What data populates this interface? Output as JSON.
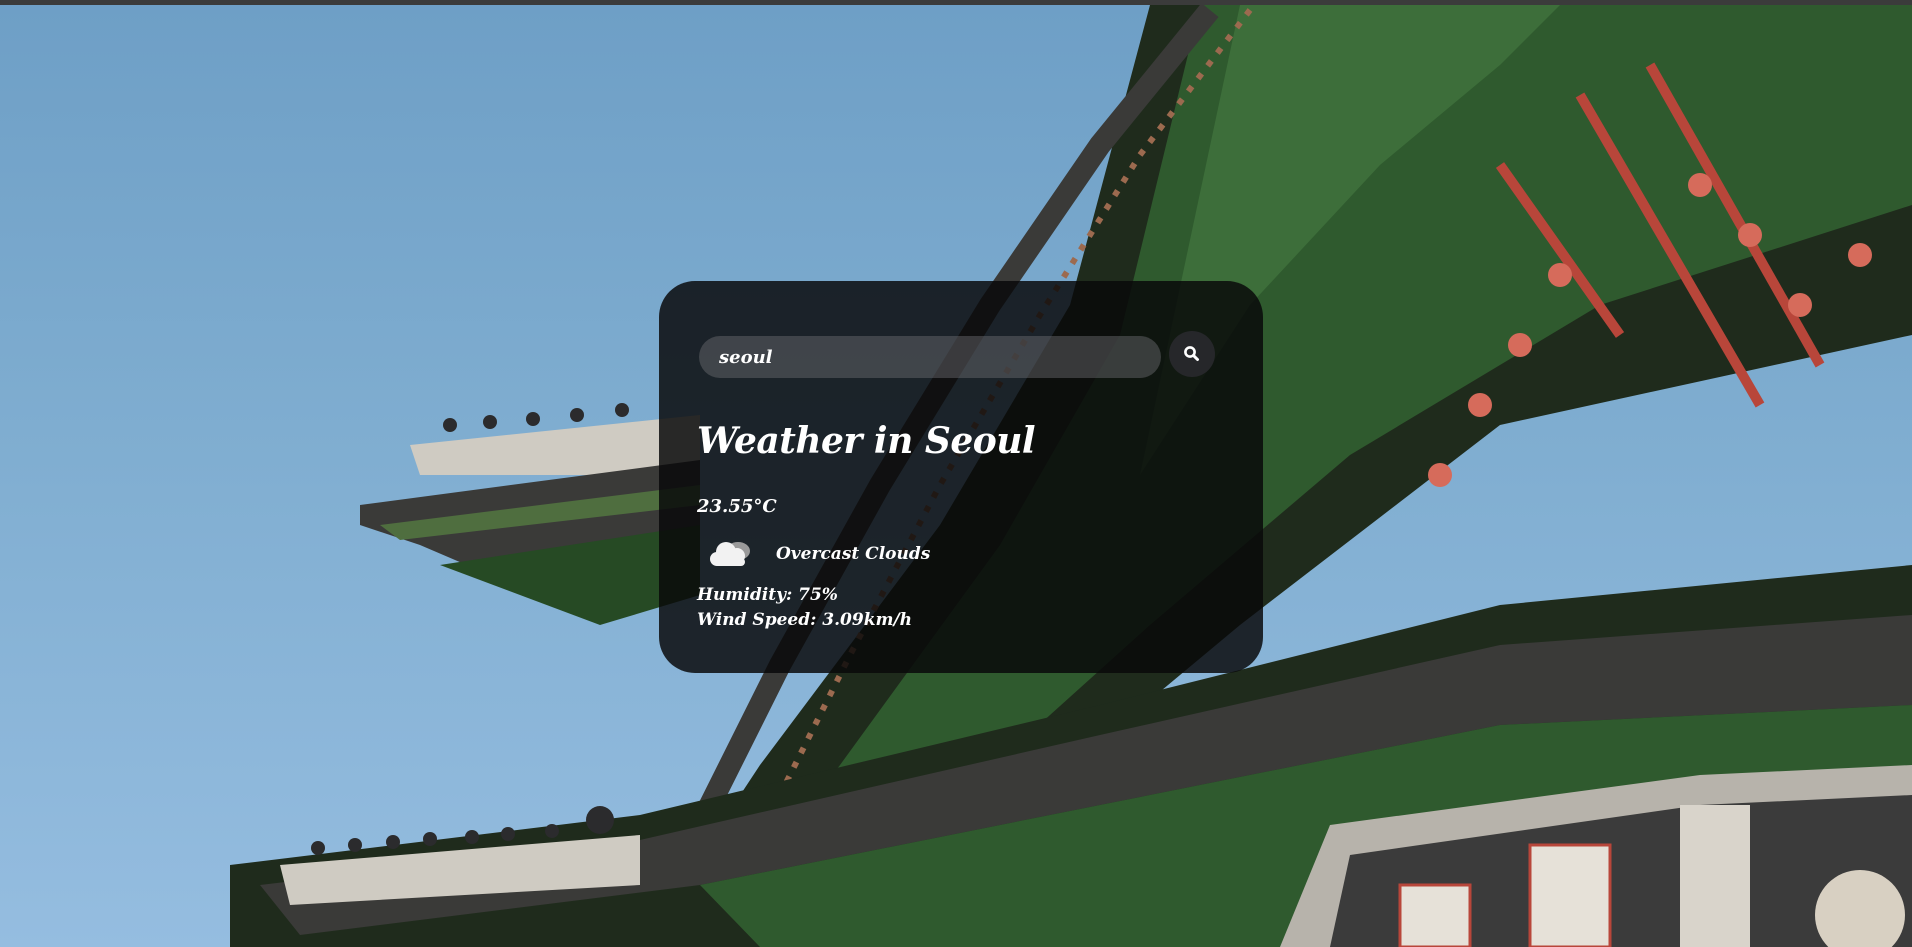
{
  "search": {
    "value": "seoul",
    "button_icon": "search-icon"
  },
  "weather": {
    "title": "Weather in Seoul",
    "temperature": "23.55°C",
    "condition_icon": "cloud-icon",
    "condition": "Overcast Clouds",
    "humidity": "Humidity: 75%",
    "wind": "Wind Speed: 3.09km/h"
  },
  "background": {
    "subject": "traditional-palace-roof-photo",
    "colors": {
      "sky": "#7fadd0",
      "roof_green": "#2f5a2e",
      "roof_dark": "#2a2a2a",
      "accent_red": "#b8463a"
    }
  },
  "colors": {
    "card_bg": "#08080a",
    "text": "#ffffff",
    "input_bg": "#5f5f64",
    "button_bg": "#28282c"
  }
}
